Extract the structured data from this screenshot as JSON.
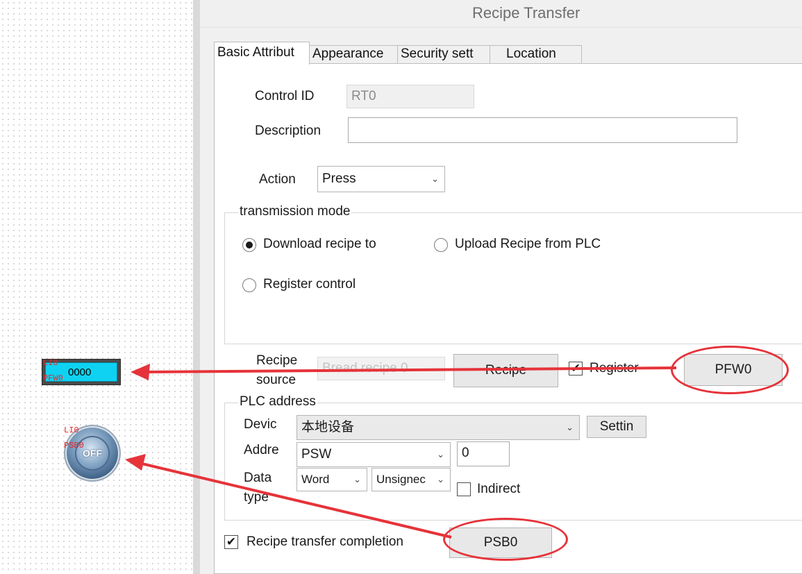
{
  "canvas": {
    "numeric_display": {
      "value": "0000",
      "tag_line1": "LI0",
      "tag_line2": "PFW0"
    },
    "indicator_lamp": {
      "label": "OFF",
      "tag_line1": "LI0",
      "tag_line2": "PSB0"
    }
  },
  "dialog": {
    "title": "Recipe Transfer",
    "tabs": [
      "Basic Attribut",
      "Appearance",
      "Security sett",
      "Location"
    ],
    "active_tab": "Basic Attribut",
    "control_id": {
      "label": "Control ID",
      "value": "RT0"
    },
    "description": {
      "label": "Description",
      "value": ""
    },
    "action": {
      "label": "Action",
      "value": "Press"
    },
    "transmission_mode": {
      "title": "transmission mode",
      "options": [
        "Download recipe to",
        "Upload Recipe from PLC",
        "Register control"
      ],
      "selected": "Download recipe to"
    },
    "recipe_source": {
      "label_line1": "Recipe",
      "label_line2": "source",
      "value": "Bread recipe 0",
      "recipe_button": "Recipe",
      "register_label": "Register",
      "register_checked": true,
      "register_button": "PFW0"
    },
    "plc_address": {
      "title": "PLC address",
      "device_label": "Devic",
      "device_value": "本地设备",
      "settings_button": "Settin",
      "address_label": "Addre",
      "address_type": "PSW",
      "address_value": "0",
      "data_type_label_line1": "Data",
      "data_type_label_line2": "type",
      "data_type": "Word",
      "signedness": "Unsignec",
      "indirect_label": "Indirect",
      "indirect_checked": false
    },
    "completion": {
      "label": "Recipe transfer completion",
      "checked": true,
      "button": "PSB0"
    }
  },
  "colors": {
    "annotation": "#e6333a",
    "display_fill": "#0fd2f2",
    "tag_text": "#e0282d"
  },
  "icons": {
    "dropdown": "chevron-down-icon",
    "checkmark": "checkmark-icon"
  }
}
